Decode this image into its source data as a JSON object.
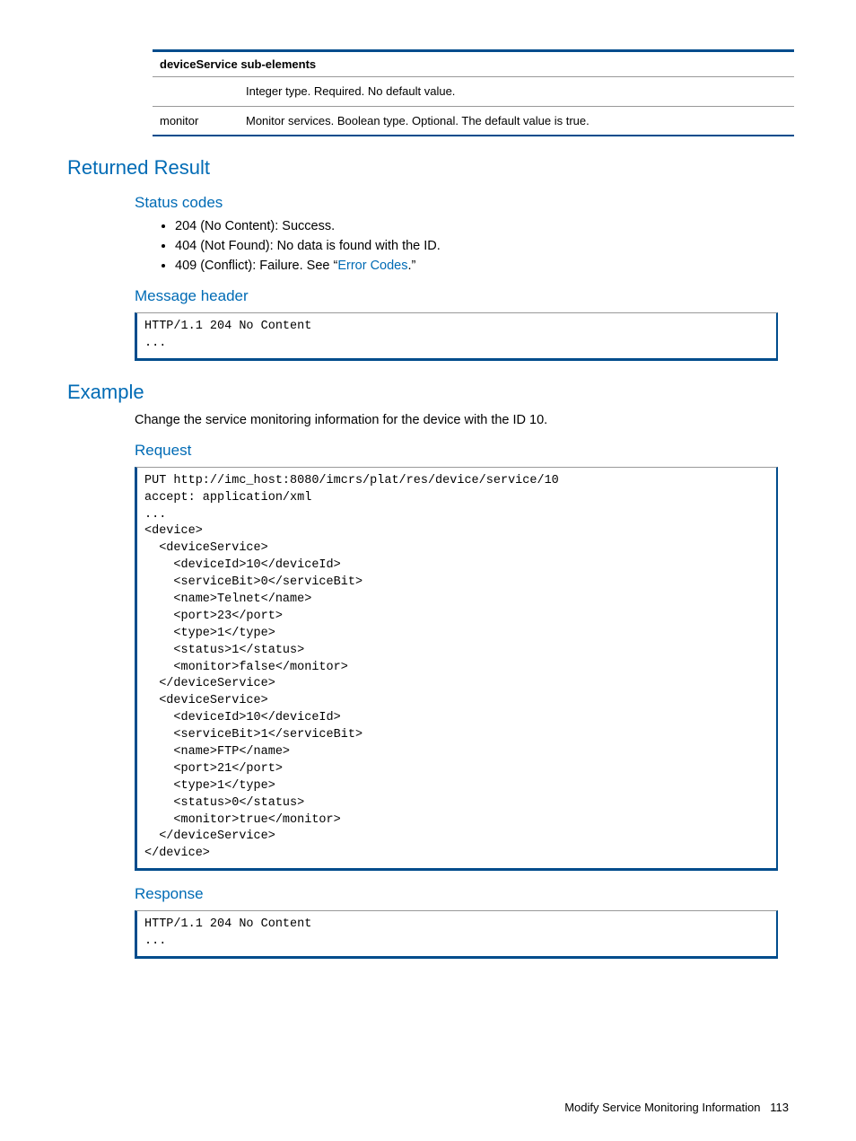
{
  "table": {
    "header": "deviceService sub-elements",
    "rows": [
      {
        "c1": "",
        "c2": "Integer type. Required. No default value."
      },
      {
        "c1": "monitor",
        "c2": "Monitor services.\nBoolean type. Optional. The default value is true."
      }
    ]
  },
  "sections": {
    "returned_result": "Returned Result",
    "status_codes": "Status codes",
    "bullets": {
      "b1": "204 (No Content): Success.",
      "b2": "404 (Not Found): No data is found with the ID.",
      "b3_a": "409 (Conflict): Failure. See “",
      "b3_link": "Error Codes",
      "b3_b": ".”"
    },
    "message_header": "Message header",
    "msg_code": "HTTP/1.1 204 No Content\n...",
    "example": "Example",
    "example_intro": "Change the service monitoring information for the device with the ID 10.",
    "request": "Request",
    "request_code": "PUT http://imc_host:8080/imcrs/plat/res/device/service/10\naccept: application/xml\n...\n<device>\n  <deviceService>\n    <deviceId>10</deviceId>\n    <serviceBit>0</serviceBit>\n    <name>Telnet</name>\n    <port>23</port>\n    <type>1</type>\n    <status>1</status>\n    <monitor>false</monitor>\n  </deviceService>\n  <deviceService>\n    <deviceId>10</deviceId>\n    <serviceBit>1</serviceBit>\n    <name>FTP</name>\n    <port>21</port>\n    <type>1</type>\n    <status>0</status>\n    <monitor>true</monitor>\n  </deviceService>\n</device>",
    "response": "Response",
    "response_code": "HTTP/1.1 204 No Content\n..."
  },
  "footer": {
    "title": "Modify Service Monitoring Information",
    "page": "113"
  }
}
